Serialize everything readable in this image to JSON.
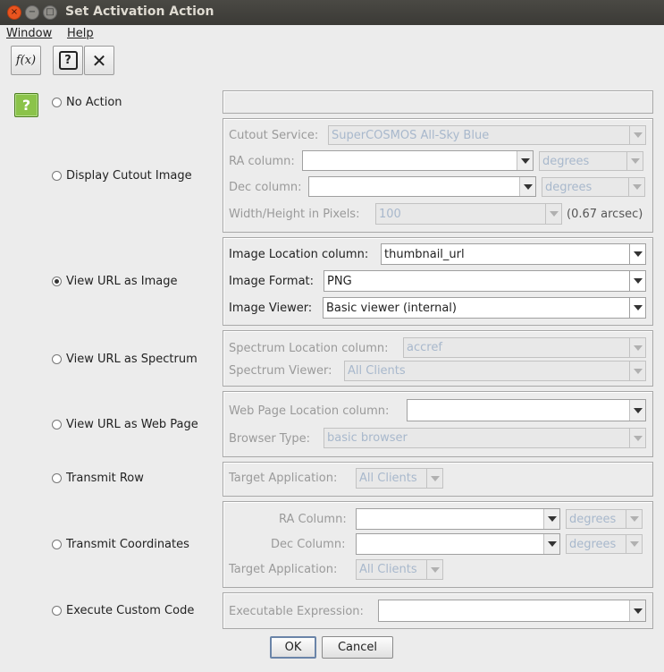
{
  "window": {
    "title": "Set Activation Action",
    "close_glyph": "×",
    "min_glyph": "−",
    "max_glyph": "□"
  },
  "menu": {
    "window_label": "Window",
    "help_label": "Help"
  },
  "toolbar": {
    "function_icon": "f(x)",
    "help_icon": "?",
    "close_icon": "✕"
  },
  "help_icon_glyph": "?",
  "options": [
    {
      "label": "No Action",
      "selected": false
    },
    {
      "label": "Display Cutout Image",
      "selected": false
    },
    {
      "label": "View URL as Image",
      "selected": true
    },
    {
      "label": "View URL as Spectrum",
      "selected": false
    },
    {
      "label": "View URL as Web Page",
      "selected": false
    },
    {
      "label": "Transmit Row",
      "selected": false
    },
    {
      "label": "Transmit Coordinates",
      "selected": false
    },
    {
      "label": "Execute Custom Code",
      "selected": false
    }
  ],
  "cutout": {
    "service_label": "Cutout Service:",
    "service_value": "SuperCOSMOS All-Sky Blue",
    "ra_label": "RA column:",
    "ra_value": "",
    "ra_units": "degrees",
    "dec_label": "Dec column:",
    "dec_value": "",
    "dec_units": "degrees",
    "size_label": "Width/Height in Pixels:",
    "size_value": "100",
    "size_note": "(0.67 arcsec)"
  },
  "image": {
    "location_label": "Image Location column:",
    "location_value": "thumbnail_url",
    "format_label": "Image Format:",
    "format_value": "PNG",
    "viewer_label": "Image Viewer:",
    "viewer_value": "Basic viewer (internal)"
  },
  "spectrum": {
    "location_label": "Spectrum Location column:",
    "location_value": "accref",
    "viewer_label": "Spectrum Viewer:",
    "viewer_value": "All Clients"
  },
  "webpage": {
    "location_label": "Web Page Location column:",
    "location_value": "",
    "browser_label": "Browser Type:",
    "browser_value": "basic browser"
  },
  "transmit_row": {
    "target_label": "Target Application:",
    "target_value": "All Clients"
  },
  "transmit_coords": {
    "ra_label": "RA Column:",
    "ra_value": "",
    "ra_units": "degrees",
    "dec_label": "Dec Column:",
    "dec_value": "",
    "dec_units": "degrees",
    "target_label": "Target Application:",
    "target_value": "All Clients"
  },
  "custom_code": {
    "expr_label": "Executable Expression:",
    "expr_value": ""
  },
  "buttons": {
    "ok": "OK",
    "cancel": "Cancel"
  }
}
